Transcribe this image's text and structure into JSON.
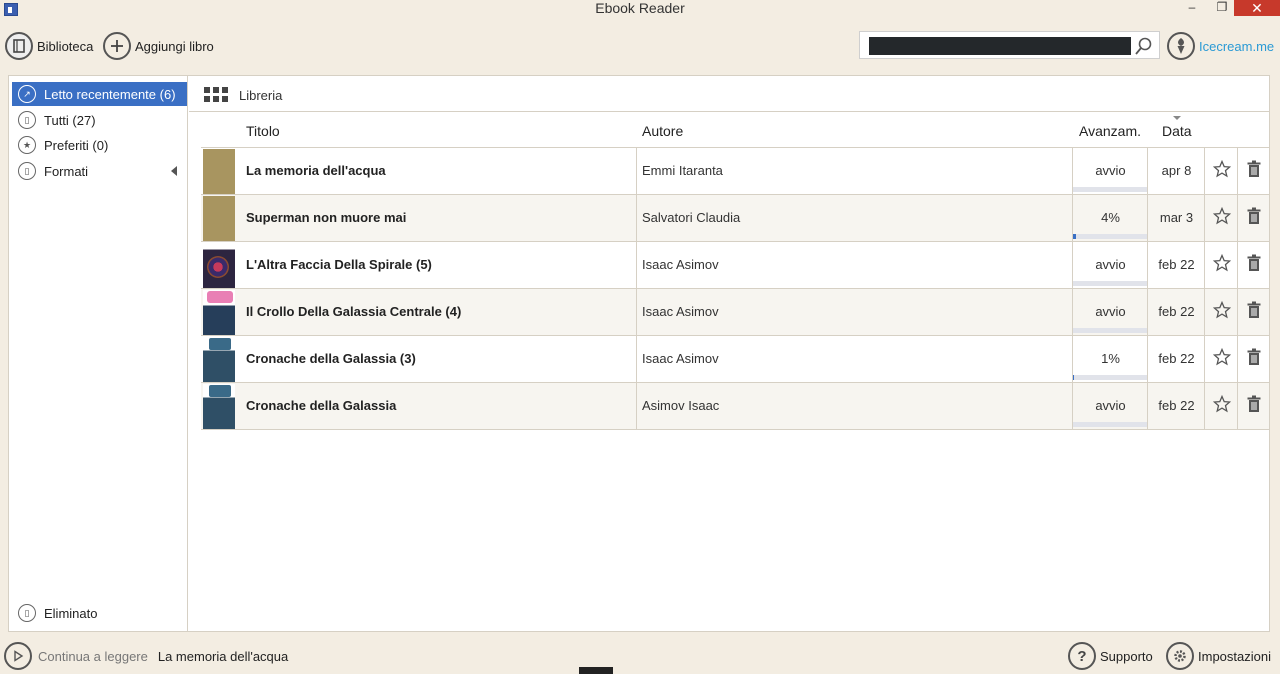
{
  "window": {
    "title": "Ebook Reader",
    "minimize": "–",
    "maximize": "❐",
    "close": "✕"
  },
  "toolbar": {
    "library_label": "Biblioteca",
    "add_book_label": "Aggiungi libro",
    "search_value": "",
    "brand_link": "Icecream.me"
  },
  "sidebar": {
    "items": [
      {
        "label": "Letto recentemente (6)",
        "icon": "recent-icon",
        "active": true
      },
      {
        "label": "Tutti (27)",
        "icon": "book-icon",
        "active": false
      },
      {
        "label": "Preferiti (0)",
        "icon": "star-icon",
        "active": false
      },
      {
        "label": "Formati",
        "icon": "book-icon",
        "active": false
      }
    ],
    "deleted_label": "Eliminato"
  },
  "library": {
    "label": "Libreria",
    "view_icon": "grid-view-icon"
  },
  "table": {
    "headers": {
      "title": "Titolo",
      "author": "Autore",
      "progress": "Avanzam.",
      "date": "Data"
    },
    "sort": {
      "column": "Data",
      "direction": "descending"
    },
    "rows": [
      {
        "title": "La memoria dell'acqua",
        "author": "Emmi Itaranta",
        "progress_text": "avvio",
        "progress_fraction": 0.0,
        "date": "apr 8",
        "cover": "plain"
      },
      {
        "title": "Superman non muore mai",
        "author": "Salvatori Claudia",
        "progress_text": "4%",
        "progress_fraction": 0.04,
        "date": "mar 3",
        "cover": "plain"
      },
      {
        "title": "L'Altra Faccia Della Spirale (5)",
        "author": "Isaac Asimov",
        "progress_text": "avvio",
        "progress_fraction": 0.0,
        "date": "feb 22",
        "cover": "spiral"
      },
      {
        "title": "Il Crollo Della Galassia Centrale (4)",
        "author": "Isaac Asimov",
        "progress_text": "avvio",
        "progress_fraction": 0.0,
        "date": "feb 22",
        "cover": "crollo"
      },
      {
        "title": "Cronache della Galassia (3)",
        "author": "Isaac Asimov",
        "progress_text": "1%",
        "progress_fraction": 0.01,
        "date": "feb 22",
        "cover": "cronache"
      },
      {
        "title": "Cronache della Galassia",
        "author": "Asimov Isaac",
        "progress_text": "avvio",
        "progress_fraction": 0.0,
        "date": "feb 22",
        "cover": "cronache"
      }
    ]
  },
  "footer": {
    "continue_label": "Continua a leggere",
    "continue_book": "La memoria dell'acqua",
    "support_label": "Supporto",
    "settings_label": "Impostazioni"
  },
  "colors": {
    "accent": "#3a6fc4",
    "background": "#f3ede2",
    "link": "#2a9ad5",
    "close": "#c7392b"
  }
}
